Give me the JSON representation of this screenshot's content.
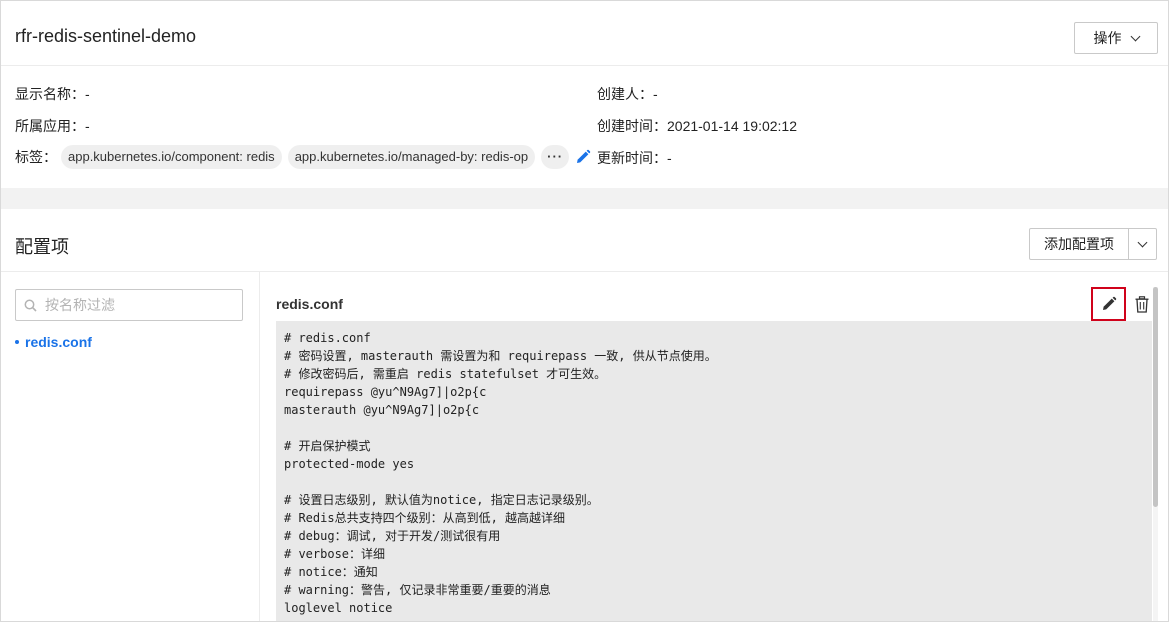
{
  "header": {
    "title": "rfr-redis-sentinel-demo",
    "action_button": "操作"
  },
  "meta": {
    "display_name": {
      "label": "显示名称：",
      "value": "-"
    },
    "app": {
      "label": "所属应用：",
      "value": "-"
    },
    "tags": {
      "label": "标签：",
      "items": [
        "app.kubernetes.io/component: redis",
        "app.kubernetes.io/managed-by: redis-op"
      ],
      "more": "···"
    },
    "creator": {
      "label": "创建人：",
      "value": "-"
    },
    "created_time": {
      "label": "创建时间：",
      "value": "2021-01-14 19:02:12"
    },
    "updated_time": {
      "label": "更新时间：",
      "value": "-"
    }
  },
  "config": {
    "title": "配置项",
    "add_button": "添加配置项",
    "filter_placeholder": "按名称过滤",
    "items": [
      "redis.conf"
    ],
    "selected_name": "redis.conf",
    "content_lines": [
      "# redis.conf",
      "# 密码设置, masterauth 需设置为和 requirepass 一致, 供从节点使用。",
      "# 修改密码后, 需重启 redis statefulset 才可生效。",
      "requirepass @yu^N9Ag7]|o2p{c",
      "masterauth @yu^N9Ag7]|o2p{c",
      "",
      "# 开启保护模式",
      "protected-mode yes",
      "",
      "# 设置日志级别, 默认值为notice, 指定日志记录级别。",
      "# Redis总共支持四个级别：从高到低, 越高越详细",
      "# debug：调试, 对于开发/测试很有用",
      "# verbose：详细",
      "# notice：通知",
      "# warning：警告, 仅记录非常重要/重要的消息",
      "loglevel notice"
    ]
  },
  "colors": {
    "link_blue": "#1a73e8",
    "highlight_red": "#d0021b",
    "code_bg": "#e9e9e9"
  }
}
